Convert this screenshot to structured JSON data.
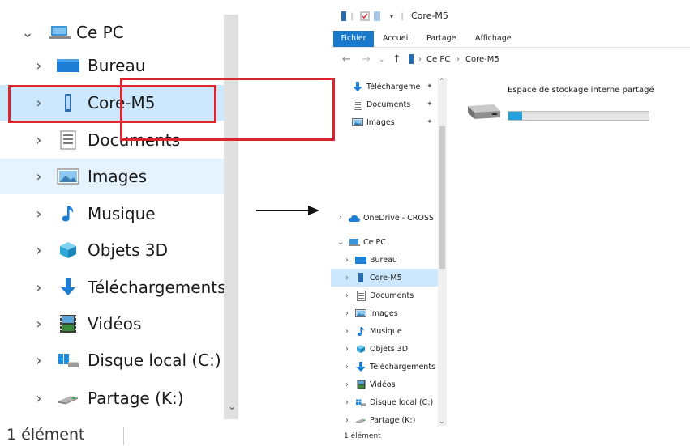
{
  "left": {
    "this_pc": "Ce PC",
    "items": [
      {
        "label": "Bureau",
        "icon": "desktop-icon"
      },
      {
        "label": "Core-M5",
        "icon": "phone-device-icon"
      },
      {
        "label": "Documents",
        "icon": "documents-icon"
      },
      {
        "label": "Images",
        "icon": "pictures-icon"
      },
      {
        "label": "Musique",
        "icon": "music-icon"
      },
      {
        "label": "Objets 3D",
        "icon": "cube-3d-icon"
      },
      {
        "label": "Téléchargements",
        "icon": "download-icon"
      },
      {
        "label": "Vidéos",
        "icon": "videos-icon"
      },
      {
        "label": "Disque local (C:)",
        "icon": "local-disk-icon"
      },
      {
        "label": "Partage (K:)",
        "icon": "network-drive-icon"
      }
    ],
    "status": "1 élément"
  },
  "window": {
    "title": "Core-M5",
    "ribbon_tabs": [
      "Fichier",
      "Accueil",
      "Partage",
      "Affichage"
    ],
    "address": [
      "Ce PC",
      "Core-M5"
    ],
    "quick_access": [
      {
        "label": "Téléchargeme",
        "icon": "download-icon"
      },
      {
        "label": "Documents",
        "icon": "documents-icon"
      },
      {
        "label": "Images",
        "icon": "pictures-icon"
      }
    ],
    "onedrive": "OneDrive - CROSS",
    "this_pc": "Ce PC",
    "nav_items": [
      {
        "label": "Bureau"
      },
      {
        "label": "Core-M5"
      },
      {
        "label": "Documents"
      },
      {
        "label": "Images"
      },
      {
        "label": "Musique"
      },
      {
        "label": "Objets 3D"
      },
      {
        "label": "Téléchargements"
      },
      {
        "label": "Vidéos"
      },
      {
        "label": "Disque local (C:)"
      },
      {
        "label": "Partage (K:)"
      }
    ],
    "storage": {
      "name": "Espace de stockage interne partagé",
      "used_fraction": 0.1
    },
    "status": "1 élément"
  },
  "colors": {
    "highlight": "#d9262f",
    "selection": "#cce8ff",
    "hover": "#e5f3ff",
    "accent": "#1979ca",
    "storage_fill": "#26a0da"
  }
}
